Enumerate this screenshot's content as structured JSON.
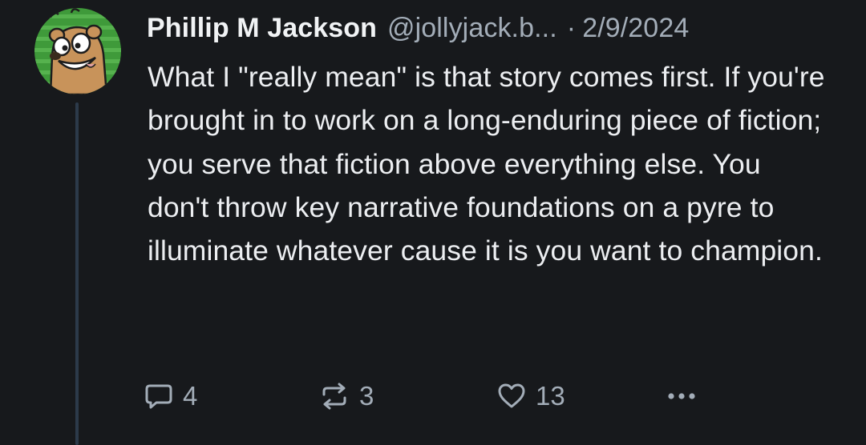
{
  "post": {
    "author": {
      "display_name": "Phillip M Jackson",
      "handle": "@jollyjack.b...",
      "avatar_icon": "cartoon-bear-avatar-icon"
    },
    "separator": "·",
    "date": "2/9/2024",
    "text": "What I \"really mean\" is that story comes first. If you're brought in to work on a long-enduring piece of fiction; you serve that fiction above everything else. You don't throw key narrative foundations on a pyre to illuminate whatever cause it is you want to champion.",
    "actions": {
      "reply": {
        "icon": "reply-icon",
        "count": "4"
      },
      "repost": {
        "icon": "repost-icon",
        "count": "3"
      },
      "like": {
        "icon": "heart-icon",
        "count": "13"
      },
      "more": {
        "icon": "more-options-icon"
      }
    }
  },
  "colors": {
    "background": "#17191c",
    "text_primary": "#eceef1",
    "text_secondary": "#a3adb8",
    "thread_line": "#2c3a4a",
    "avatar_bg": "#3f9a3a"
  }
}
